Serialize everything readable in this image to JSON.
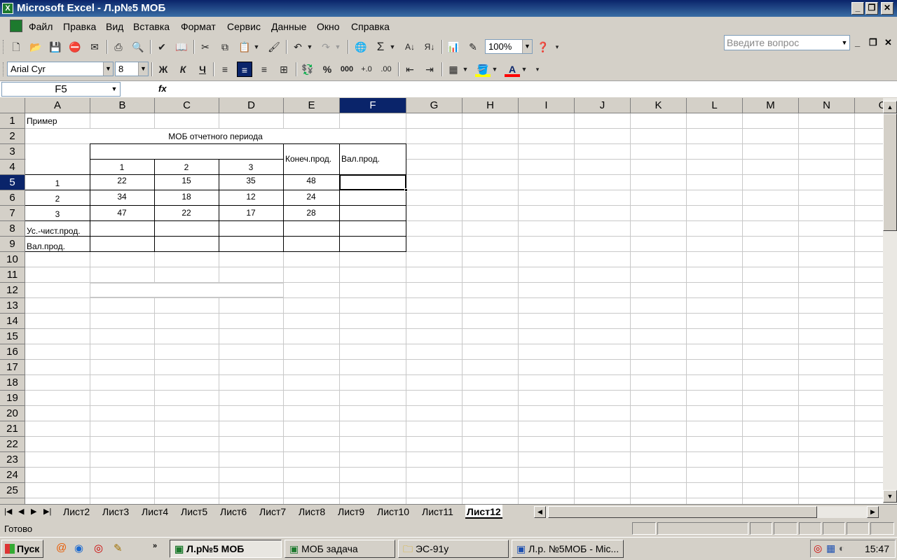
{
  "window": {
    "title": "Microsoft Excel - Л.р№5 МОБ",
    "app_icon": "excel-icon"
  },
  "menu": {
    "items": [
      "Файл",
      "Правка",
      "Вид",
      "Вставка",
      "Формат",
      "Сервис",
      "Данные",
      "Окно",
      "Справка"
    ],
    "ask_placeholder": "Введите вопрос"
  },
  "toolbar": {
    "zoom": "100%",
    "font": "Arial Cyr",
    "font_size": "8",
    "bold": "Ж",
    "italic": "К",
    "underline": "Ч",
    "sum": "Σ",
    "percent": "%",
    "thousands": "000"
  },
  "formula_bar": {
    "name_box": "F5",
    "fx": "fx",
    "content": ""
  },
  "grid": {
    "columns": [
      "A",
      "B",
      "C",
      "D",
      "E",
      "F",
      "G",
      "H",
      "I",
      "J",
      "K",
      "L",
      "M",
      "N",
      "O"
    ],
    "rows": [
      "1",
      "2",
      "3",
      "4",
      "5",
      "6",
      "7",
      "8",
      "9",
      "10",
      "11",
      "12",
      "13",
      "14",
      "15",
      "16",
      "17",
      "18",
      "19",
      "20",
      "21",
      "22",
      "23",
      "24",
      "25"
    ],
    "selected_cell": "F5",
    "cells": {
      "A1": "Пример",
      "title": "МОБ отчетного периода",
      "B4": "1",
      "C4": "2",
      "D4": "3",
      "E3": "Конеч.прод.",
      "F3": "Вал.прод.",
      "A5": "1",
      "A6": "2",
      "A7": "3",
      "B5": "22",
      "C5": "15",
      "D5": "35",
      "E5": "48",
      "B6": "34",
      "C6": "18",
      "D6": "12",
      "E6": "24",
      "B7": "47",
      "C7": "22",
      "D7": "17",
      "E7": "28",
      "A8": "Ус.-чист.прод.",
      "A9": "Вал.прод."
    }
  },
  "sheets": {
    "tabs": [
      "Лист2",
      "Лист3",
      "Лист4",
      "Лист5",
      "Лист6",
      "Лист7",
      "Лист8",
      "Лист9",
      "Лист10",
      "Лист11",
      "Лист12"
    ],
    "active": "Лист12"
  },
  "status": {
    "text": "Готово"
  },
  "taskbar": {
    "start": "Пуск",
    "buttons": [
      "Л.р№5 МОБ",
      "МОБ задача",
      "ЭС-91у",
      "Л.р. №5МОБ - Mic..."
    ],
    "active_button": "Л.р№5 МОБ",
    "clock": "15:47"
  }
}
